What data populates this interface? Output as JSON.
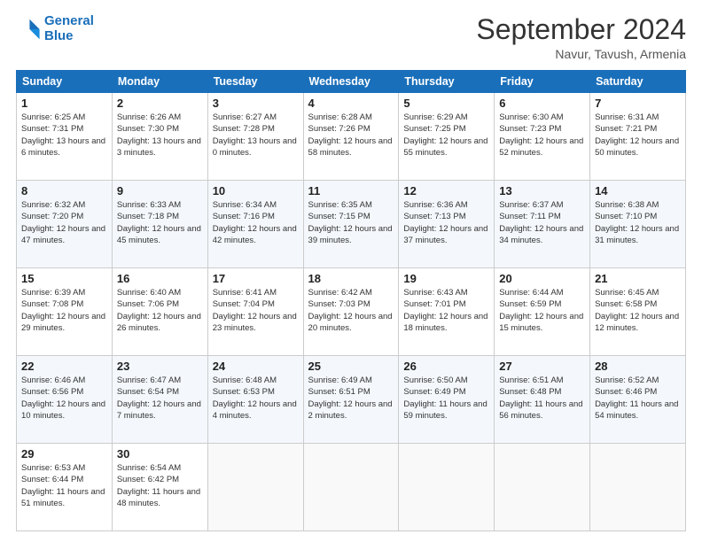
{
  "header": {
    "logo_line1": "General",
    "logo_line2": "Blue",
    "month": "September 2024",
    "location": "Navur, Tavush, Armenia"
  },
  "weekdays": [
    "Sunday",
    "Monday",
    "Tuesday",
    "Wednesday",
    "Thursday",
    "Friday",
    "Saturday"
  ],
  "weeks": [
    [
      {
        "day": "1",
        "sunrise": "6:25 AM",
        "sunset": "7:31 PM",
        "daylight": "13 hours and 6 minutes."
      },
      {
        "day": "2",
        "sunrise": "6:26 AM",
        "sunset": "7:30 PM",
        "daylight": "13 hours and 3 minutes."
      },
      {
        "day": "3",
        "sunrise": "6:27 AM",
        "sunset": "7:28 PM",
        "daylight": "13 hours and 0 minutes."
      },
      {
        "day": "4",
        "sunrise": "6:28 AM",
        "sunset": "7:26 PM",
        "daylight": "12 hours and 58 minutes."
      },
      {
        "day": "5",
        "sunrise": "6:29 AM",
        "sunset": "7:25 PM",
        "daylight": "12 hours and 55 minutes."
      },
      {
        "day": "6",
        "sunrise": "6:30 AM",
        "sunset": "7:23 PM",
        "daylight": "12 hours and 52 minutes."
      },
      {
        "day": "7",
        "sunrise": "6:31 AM",
        "sunset": "7:21 PM",
        "daylight": "12 hours and 50 minutes."
      }
    ],
    [
      {
        "day": "8",
        "sunrise": "6:32 AM",
        "sunset": "7:20 PM",
        "daylight": "12 hours and 47 minutes."
      },
      {
        "day": "9",
        "sunrise": "6:33 AM",
        "sunset": "7:18 PM",
        "daylight": "12 hours and 45 minutes."
      },
      {
        "day": "10",
        "sunrise": "6:34 AM",
        "sunset": "7:16 PM",
        "daylight": "12 hours and 42 minutes."
      },
      {
        "day": "11",
        "sunrise": "6:35 AM",
        "sunset": "7:15 PM",
        "daylight": "12 hours and 39 minutes."
      },
      {
        "day": "12",
        "sunrise": "6:36 AM",
        "sunset": "7:13 PM",
        "daylight": "12 hours and 37 minutes."
      },
      {
        "day": "13",
        "sunrise": "6:37 AM",
        "sunset": "7:11 PM",
        "daylight": "12 hours and 34 minutes."
      },
      {
        "day": "14",
        "sunrise": "6:38 AM",
        "sunset": "7:10 PM",
        "daylight": "12 hours and 31 minutes."
      }
    ],
    [
      {
        "day": "15",
        "sunrise": "6:39 AM",
        "sunset": "7:08 PM",
        "daylight": "12 hours and 29 minutes."
      },
      {
        "day": "16",
        "sunrise": "6:40 AM",
        "sunset": "7:06 PM",
        "daylight": "12 hours and 26 minutes."
      },
      {
        "day": "17",
        "sunrise": "6:41 AM",
        "sunset": "7:04 PM",
        "daylight": "12 hours and 23 minutes."
      },
      {
        "day": "18",
        "sunrise": "6:42 AM",
        "sunset": "7:03 PM",
        "daylight": "12 hours and 20 minutes."
      },
      {
        "day": "19",
        "sunrise": "6:43 AM",
        "sunset": "7:01 PM",
        "daylight": "12 hours and 18 minutes."
      },
      {
        "day": "20",
        "sunrise": "6:44 AM",
        "sunset": "6:59 PM",
        "daylight": "12 hours and 15 minutes."
      },
      {
        "day": "21",
        "sunrise": "6:45 AM",
        "sunset": "6:58 PM",
        "daylight": "12 hours and 12 minutes."
      }
    ],
    [
      {
        "day": "22",
        "sunrise": "6:46 AM",
        "sunset": "6:56 PM",
        "daylight": "12 hours and 10 minutes."
      },
      {
        "day": "23",
        "sunrise": "6:47 AM",
        "sunset": "6:54 PM",
        "daylight": "12 hours and 7 minutes."
      },
      {
        "day": "24",
        "sunrise": "6:48 AM",
        "sunset": "6:53 PM",
        "daylight": "12 hours and 4 minutes."
      },
      {
        "day": "25",
        "sunrise": "6:49 AM",
        "sunset": "6:51 PM",
        "daylight": "12 hours and 2 minutes."
      },
      {
        "day": "26",
        "sunrise": "6:50 AM",
        "sunset": "6:49 PM",
        "daylight": "11 hours and 59 minutes."
      },
      {
        "day": "27",
        "sunrise": "6:51 AM",
        "sunset": "6:48 PM",
        "daylight": "11 hours and 56 minutes."
      },
      {
        "day": "28",
        "sunrise": "6:52 AM",
        "sunset": "6:46 PM",
        "daylight": "11 hours and 54 minutes."
      }
    ],
    [
      {
        "day": "29",
        "sunrise": "6:53 AM",
        "sunset": "6:44 PM",
        "daylight": "11 hours and 51 minutes."
      },
      {
        "day": "30",
        "sunrise": "6:54 AM",
        "sunset": "6:42 PM",
        "daylight": "11 hours and 48 minutes."
      },
      null,
      null,
      null,
      null,
      null
    ]
  ]
}
